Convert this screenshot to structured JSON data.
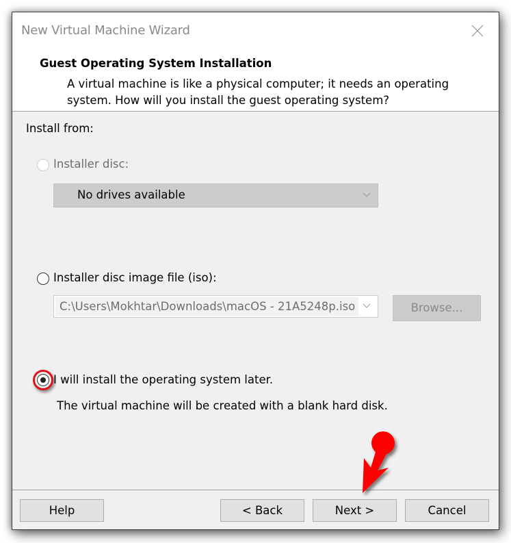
{
  "window": {
    "title": "New Virtual Machine Wizard",
    "close_icon": "close-x-icon"
  },
  "header": {
    "title": "Guest Operating System Installation",
    "description": "A virtual machine is like a physical computer; it needs an operating system. How will you install the guest operating system?"
  },
  "install_from": {
    "label": "Install from:",
    "options": [
      {
        "label": "Installer disc:",
        "checked": false,
        "enabled": false,
        "dropdown_value": "No drives available"
      },
      {
        "label": "Installer disc image file (iso):",
        "checked": false,
        "enabled": true,
        "dropdown_value": "C:\\Users\\Mokhtar\\Downloads\\macOS - 21A5248p.iso",
        "browse_label": "Browse..."
      },
      {
        "label": "I will install the operating system later.",
        "checked": true,
        "enabled": true,
        "description": "The virtual machine will be created with a blank hard disk."
      }
    ]
  },
  "footer": {
    "help_label": "Help",
    "back_label": "< Back",
    "next_label": "Next >",
    "cancel_label": "Cancel"
  },
  "annotations": {
    "highlight_color": "#e0101a",
    "arrow_color": "#ff0000",
    "arrow_target": "Next >"
  }
}
